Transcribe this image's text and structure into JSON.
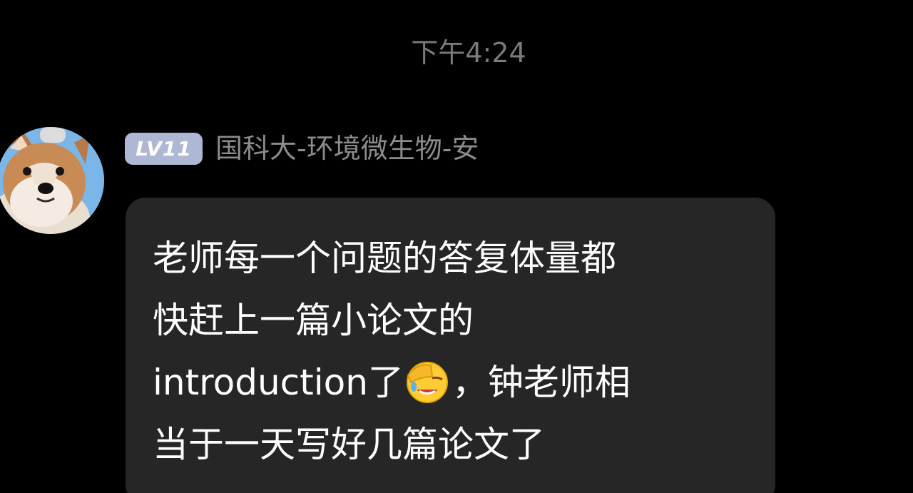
{
  "chat": {
    "timestamp": "下午4:24",
    "message": {
      "sender": {
        "level_badge": "LV11",
        "name": "国科大-环境微生物-安",
        "avatar_icon": "shiba-inu-dog-avatar"
      },
      "lines": {
        "l1": "老师每一个问题的答复体量都",
        "l2": "快赶上一篇小论文的",
        "l3a": "introduction了",
        "l3_emoji": "facepalm-laughing-emoji",
        "l3b": "，钟老师相",
        "l4": "当于一天写好几篇论文了"
      }
    }
  },
  "colors": {
    "background": "#000000",
    "bubble": "#262626",
    "level_badge": "#aeb7d3",
    "timestamp_text": "#7b7b7b",
    "name_text": "#8c8c8c",
    "message_text": "#ffffff"
  }
}
